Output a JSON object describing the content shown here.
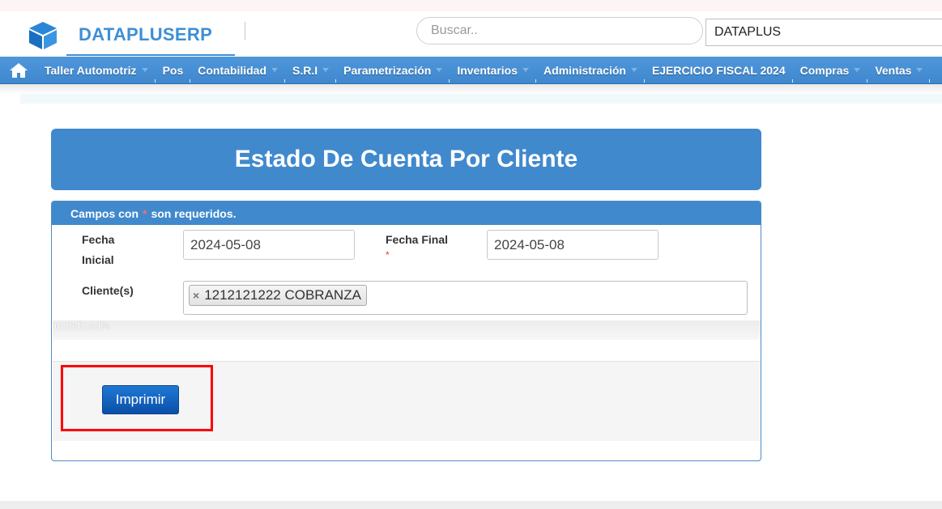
{
  "brand": {
    "name": "DATAPLUSERP",
    "icon": "cube-logo-icon"
  },
  "header": {
    "search_placeholder": "Buscar..",
    "company_value": "DATAPLUS"
  },
  "nav": {
    "home_icon": "home-icon",
    "items": [
      {
        "label": "Taller Automotriz",
        "has_menu": true
      },
      {
        "label": "Pos",
        "has_menu": false
      },
      {
        "label": "Contabilidad",
        "has_menu": true
      },
      {
        "label": "S.R.I",
        "has_menu": true
      },
      {
        "label": "Parametrización",
        "has_menu": true
      },
      {
        "label": "Inventarios",
        "has_menu": true
      },
      {
        "label": "Administración",
        "has_menu": true
      },
      {
        "label": "EJERCICIO FISCAL 2024",
        "has_menu": false
      },
      {
        "label": "Compras",
        "has_menu": true
      },
      {
        "label": "Ventas",
        "has_menu": true
      }
    ]
  },
  "page": {
    "title": "Estado De Cuenta Por Cliente"
  },
  "form": {
    "required_note_prefix": "Campos con",
    "required_mark": "*",
    "required_note_suffix": "son requeridos.",
    "fecha_inicial_label_1": "Fecha",
    "fecha_inicial_label_2": "Inicial",
    "fecha_inicial_value": "2024-05-08",
    "fecha_final_label": "Fecha Final",
    "fecha_final_required": "*",
    "fecha_final_value": "2024-05-08",
    "cliente_label": "Cliente(s)",
    "cliente_remove": "×",
    "cliente_selected": "1212121222 COBRANZA",
    "hint_text": "undefined%",
    "print_button": "Imprimir"
  },
  "colors": {
    "primary": "#4089cd",
    "brand": "#3d8fd6",
    "button": "#1565c0",
    "highlight": "#ff0000"
  }
}
